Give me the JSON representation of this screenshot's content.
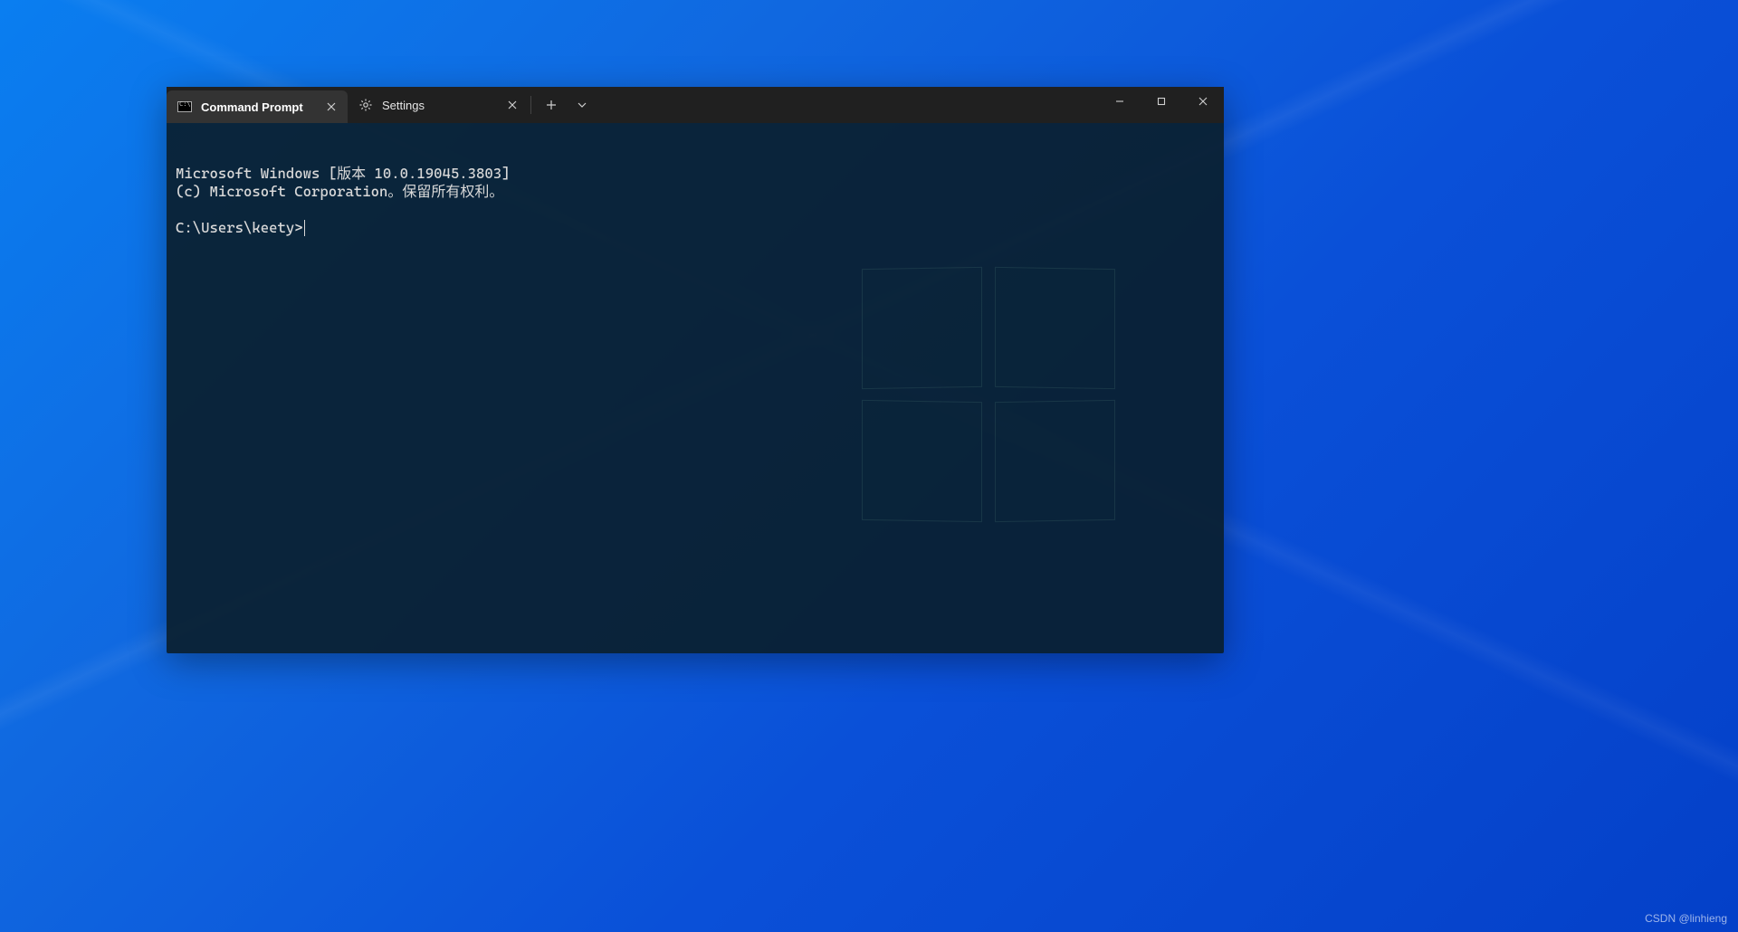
{
  "tabs": [
    {
      "label": "Command Prompt",
      "icon": "cmd-icon"
    },
    {
      "label": "Settings",
      "icon": "settings-icon"
    }
  ],
  "terminal": {
    "line1": "Microsoft Windows [版本 10.0.19045.3803]",
    "line2": "(c) Microsoft Corporation。保留所有权利。",
    "prompt": "C:\\Users\\keety>"
  },
  "watermark": "CSDN @linhieng"
}
